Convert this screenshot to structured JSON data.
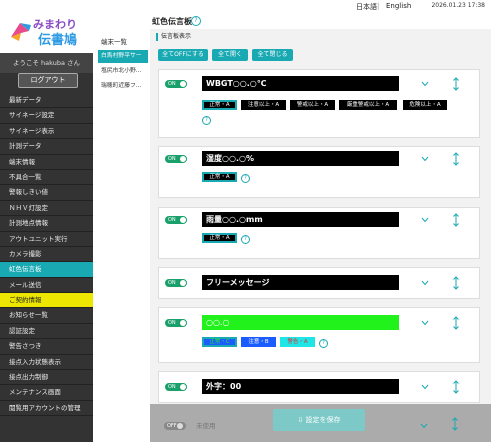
{
  "topbar": {
    "lang_ja": "日本語",
    "lang_sep": "|",
    "lang_en": "English",
    "datetime": "2026.01.23 17:38"
  },
  "sidebar": {
    "logo_line1": "みまわり",
    "logo_line2": "伝書鳩",
    "welcome": "ようこそ hakuba さん",
    "logout": "ログアウト",
    "items": [
      {
        "label": "最新データ"
      },
      {
        "label": "サイネージ設定"
      },
      {
        "label": "サイネージ表示"
      },
      {
        "label": "計測データ"
      },
      {
        "label": "端末情報"
      },
      {
        "label": "不具合一覧"
      },
      {
        "label": "警報しきい値"
      },
      {
        "label": "ＮＨＶ灯設定"
      },
      {
        "label": "計測地点情報"
      },
      {
        "label": "アウトユニット実行"
      },
      {
        "label": "カメラ撮影"
      },
      {
        "label": "虹色伝言板"
      },
      {
        "label": "メール送信"
      },
      {
        "label": "ご契約情報"
      },
      {
        "label": "お知らせ一覧"
      },
      {
        "label": "認証設定"
      },
      {
        "label": "警告さつき"
      },
      {
        "label": "接点入力状態表示"
      },
      {
        "label": "接点出力制御"
      },
      {
        "label": "メンテナンス画面"
      },
      {
        "label": "閲覧用アカウントの管理"
      }
    ]
  },
  "subcol": {
    "header": "端末一覧",
    "items": [
      {
        "label": "白馬村野平サー"
      },
      {
        "label": "塩尻市北小野…"
      },
      {
        "label": "瑞穂町近藤フ…"
      }
    ]
  },
  "main": {
    "title": "虹色伝言板",
    "help": "?",
    "section_label": "伝言板表示",
    "toolbar": {
      "all_off": "全てOFFにする",
      "open_all": "全て開く",
      "close_all": "全て閉じる"
    },
    "cards": [
      {
        "toggle": "ON",
        "text": "WBGT○○.○℃",
        "chips": [
          "正常・A",
          "注意以上・A",
          "警戒以上・A",
          "厳重警戒以上・A",
          "危険以上・A"
        ]
      },
      {
        "toggle": "ON",
        "text": "湿度○○.○%",
        "chips": [
          "正常・A"
        ]
      },
      {
        "toggle": "ON",
        "text": "雨量○○.○mm",
        "chips": [
          "正常・A"
        ]
      },
      {
        "toggle": "ON",
        "text": "フリーメッセージ",
        "chips": []
      },
      {
        "toggle": "ON",
        "text": "○○.○",
        "chips": [
          "正常・C",
          "注意・B",
          "警告・A"
        ]
      },
      {
        "toggle": "ON",
        "text": "外字：00",
        "chips": []
      }
    ],
    "save_row": {
      "toggle": "OFF",
      "placeholder": "未使用"
    },
    "save_button": "設定を保存"
  },
  "colors": {
    "accent": "#19a9b3",
    "sidebar": "#333333",
    "highlight_yellow": "#ece600",
    "toggle_on": "#1aa06b",
    "chip_green": "#22f21c",
    "chip_blue": "#1a5cff",
    "chip_cyan": "#1fe6e6"
  }
}
